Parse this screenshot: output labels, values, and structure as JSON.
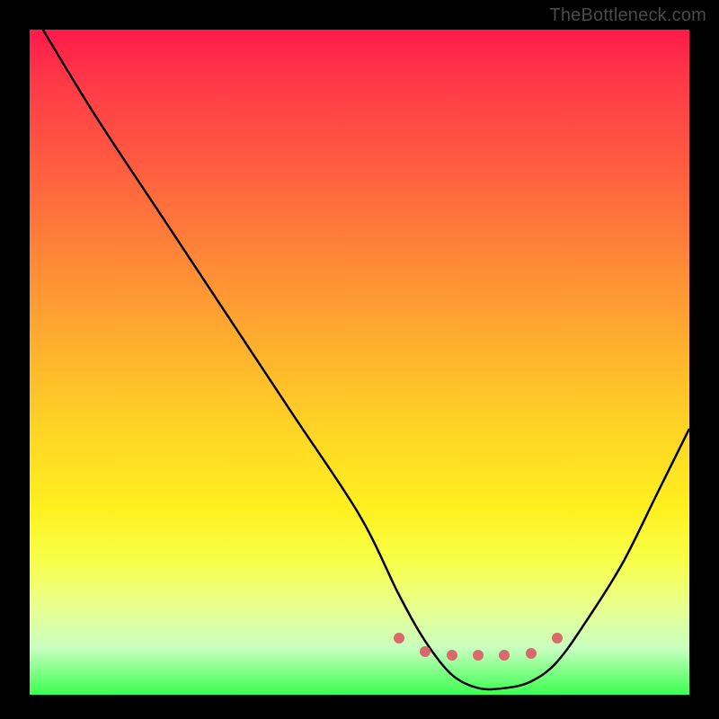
{
  "attribution": "TheBottleneck.com",
  "colors": {
    "page_bg": "#000000",
    "gradient_top": "#ff1a4a",
    "gradient_bottom": "#3aff50",
    "curve_stroke": "#000000",
    "marker_fill": "#d86a6a",
    "attribution_text": "#4a4a4a"
  },
  "chart_data": {
    "type": "line",
    "title": "",
    "xlabel": "",
    "ylabel": "",
    "xlim": [
      0,
      100
    ],
    "ylim": [
      0,
      100
    ],
    "grid": false,
    "legend": false,
    "series": [
      {
        "name": "bottleneck-curve",
        "x": [
          2,
          10,
          20,
          30,
          40,
          50,
          56,
          60,
          64,
          68,
          72,
          76,
          80,
          85,
          90,
          95,
          100
        ],
        "values": [
          100,
          87,
          72,
          57,
          42,
          27,
          15,
          8,
          3,
          1,
          1,
          2,
          5,
          12,
          20,
          30,
          40
        ]
      }
    ],
    "markers": {
      "name": "optimal-range",
      "x": [
        56,
        60,
        64,
        68,
        72,
        76,
        80
      ],
      "values": [
        8.5,
        6.5,
        6,
        6,
        6,
        6.2,
        8.5
      ]
    },
    "description": "V-shaped bottleneck curve over a vertical green-to-red gradient background; valley with salmon dot markers marks the optimal range."
  }
}
